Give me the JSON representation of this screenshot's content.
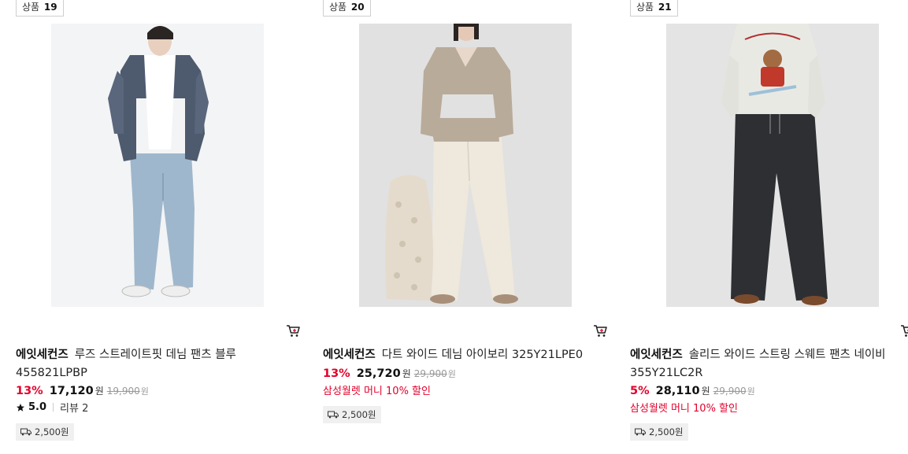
{
  "products": [
    {
      "badge_label": "상품",
      "badge_num": "19",
      "brand": "에잇세컨즈",
      "name": "루즈 스트레이트핏 데님 팬츠 블루 455821LPBP",
      "discount": "13%",
      "sale_price": "17,120",
      "currency": "원",
      "original_price": "19,900",
      "rating_score": "5.0",
      "review_label": "리뷰 2",
      "shipping_fee": "2,500원"
    },
    {
      "badge_label": "상품",
      "badge_num": "20",
      "brand": "에잇세컨즈",
      "name": "다트 와이드 데님 아이보리 325Y21LPE0",
      "discount": "13%",
      "sale_price": "25,720",
      "currency": "원",
      "original_price": "29,900",
      "promo": "삼성월렛 머니 10% 할인",
      "shipping_fee": "2,500원"
    },
    {
      "badge_label": "상품",
      "badge_num": "21",
      "brand": "에잇세컨즈",
      "name": "솔리드 와이드 스트링 스웨트 팬츠 네이비 355Y21LC2R",
      "discount": "5%",
      "sale_price": "28,110",
      "currency": "원",
      "original_price": "29,900",
      "promo": "삼성월렛 머니 10% 할인",
      "shipping_fee": "2,500원"
    }
  ],
  "icons": {
    "cart": "cart-icon",
    "star": "star-icon",
    "truck": "truck-icon"
  },
  "colors": {
    "discount": "#e4002b",
    "badge_border": "#cfcfcf",
    "shipping_bg": "#f0f0f0"
  }
}
